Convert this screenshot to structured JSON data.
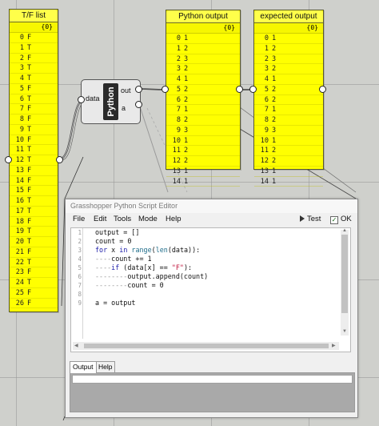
{
  "tf_panel": {
    "title": "T/F list",
    "path": "{0}",
    "rows": [
      "F",
      "T",
      "F",
      "T",
      "T",
      "F",
      "T",
      "F",
      "F",
      "T",
      "F",
      "T",
      "T",
      "F",
      "F",
      "F",
      "T",
      "T",
      "F",
      "T",
      "T",
      "F",
      "T",
      "F",
      "T",
      "F",
      "F"
    ]
  },
  "python_output_panel": {
    "title": "Python output",
    "path": "{0}",
    "rows": [
      "1",
      "2",
      "3",
      "2",
      "1",
      "2",
      "2",
      "1",
      "2",
      "3",
      "1",
      "2",
      "2",
      "1",
      "1"
    ]
  },
  "expected_output_panel": {
    "title": "expected output",
    "path": "{0}",
    "rows": [
      "1",
      "2",
      "3",
      "2",
      "1",
      "2",
      "2",
      "1",
      "2",
      "3",
      "1",
      "2",
      "2",
      "1",
      "1"
    ]
  },
  "component": {
    "name": "Python",
    "input_label": "data",
    "output_label": "out",
    "output_label_2": "a"
  },
  "editor": {
    "title": "Grasshopper Python Script Editor",
    "menu": [
      "File",
      "Edit",
      "Tools",
      "Mode",
      "Help"
    ],
    "test_label": "Test",
    "ok_label": "OK",
    "line_numbers": [
      "1",
      "2",
      "3",
      "4",
      "5",
      "6",
      "7",
      "8",
      "9"
    ],
    "code": {
      "l1": "output = []",
      "l2": "count = 0",
      "l3_kw1": "for",
      "l3_a": " x ",
      "l3_kw2": "in",
      "l3_fn1": "range",
      "l3_b": "(",
      "l3_fn2": "len",
      "l3_c": "(data)):",
      "l4_dots": "----",
      "l4": "count += 1",
      "l5_dots": "----",
      "l5_kw": "if",
      "l5_a": " (data[x] == ",
      "l5_str": "\"F\"",
      "l5_b": "):",
      "l6_dots": "--------",
      "l6": "output.append(count)",
      "l7_dots": "--------",
      "l7": "count = 0",
      "l9": "a = output"
    },
    "tabs": [
      "Output",
      "Help"
    ]
  }
}
